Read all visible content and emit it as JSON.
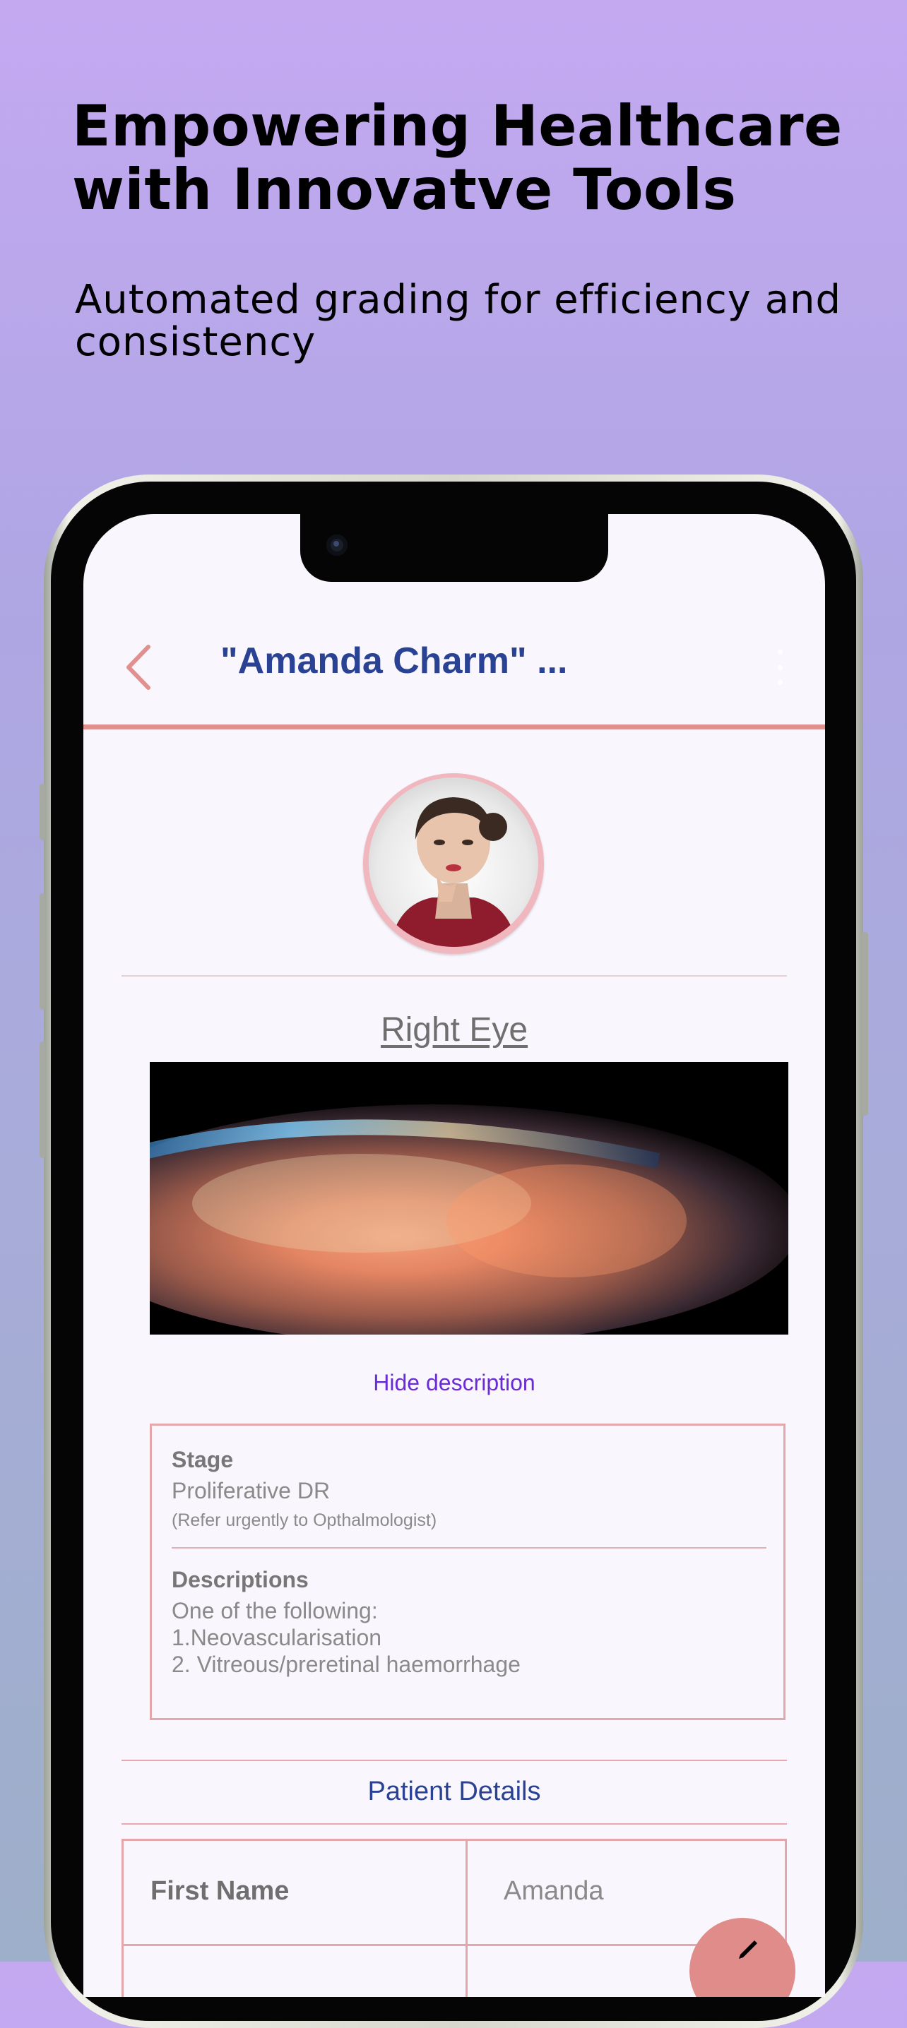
{
  "hero": {
    "headline": "Empowering Healthcare with Innovatve Tools",
    "subheadline": "Automated grading for efficiency and consistency"
  },
  "app": {
    "title": "\"Amanda Charm\"  ...",
    "section_title": "Right Eye",
    "hide_description": "Hide description",
    "description_card": {
      "stage_label": "Stage",
      "stage_value": "Proliferative DR",
      "stage_note": "(Refer urgently to Opthalmologist)",
      "descriptions_label": "Descriptions",
      "descriptions_lines": [
        "One of the following:",
        "1.Neovascularisation",
        "2. Vitreous/preretinal haemorrhage"
      ]
    },
    "patient_details": {
      "title": "Patient Details",
      "rows": [
        {
          "key": "First Name",
          "value": "Amanda"
        }
      ]
    }
  },
  "colors": {
    "accent_pink": "#e0918f",
    "title_blue": "#2a4293",
    "link_purple": "#6a2cd4"
  },
  "icons": {
    "back": "chevron-left-icon",
    "more": "more-vertical-icon",
    "fab": "edit-icon"
  }
}
